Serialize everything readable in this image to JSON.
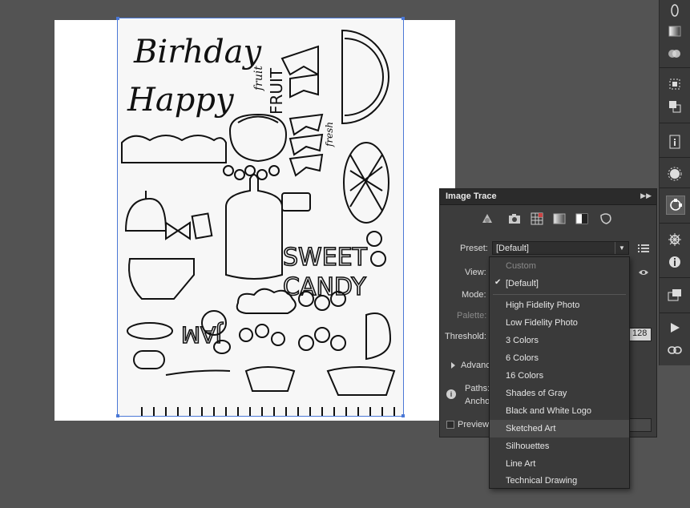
{
  "panel": {
    "title": "Image Trace",
    "preset_label": "Preset:",
    "preset_value": "[Default]",
    "view_label": "View:",
    "mode_label": "Mode:",
    "palette_label": "Palette:",
    "threshold_label": "Threshold:",
    "threshold_value": "128",
    "advanced_label": "Advanced",
    "paths_label": "Paths:",
    "anchors_label": "Anchors:",
    "preview_label": "Preview"
  },
  "preset_menu": {
    "items": [
      {
        "label": "Custom",
        "disabled": true
      },
      {
        "label": "[Default]",
        "checked": true
      },
      {
        "label": "High Fidelity Photo"
      },
      {
        "label": "Low Fidelity Photo"
      },
      {
        "label": "3 Colors"
      },
      {
        "label": "6 Colors"
      },
      {
        "label": "16 Colors"
      },
      {
        "label": "Shades of Gray"
      },
      {
        "label": "Black and White Logo"
      },
      {
        "label": "Sketched Art",
        "highlighted": true
      },
      {
        "label": "Silhouettes"
      },
      {
        "label": "Line Art"
      },
      {
        "label": "Technical Drawing"
      }
    ]
  },
  "artwork_text": {
    "birthday": "Birhday",
    "happy": "Happy",
    "fruit_small": "fruit",
    "fruit_big": "FRUIT",
    "sweet": "SWEET",
    "candy": "CANDY",
    "jam": "JAM",
    "fresh": "fresh"
  },
  "dock_icons": [
    "opacity-icon",
    "gradient-icon",
    "appearance-icon",
    "align-icon",
    "pathfinder-icon",
    "info-icon",
    "symbols-icon",
    "image-trace-icon",
    "navigator-icon",
    "attributes-icon",
    "artboards-icon",
    "actions-icon",
    "links-icon"
  ],
  "colors": {
    "selection": "#4b78d6",
    "panel_bg": "#3c3c3c",
    "canvas_bg": "#535353"
  }
}
